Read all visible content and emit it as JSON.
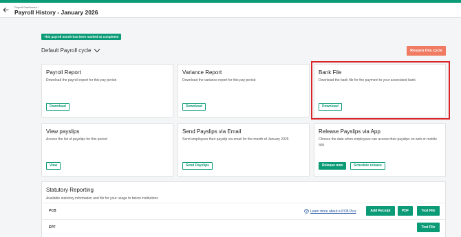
{
  "header": {
    "breadcrumb": "Payroll Dashboard /",
    "title": "Payroll History - January 2026"
  },
  "banner": "This payroll month has been marked as completed",
  "cycle": {
    "label": "Default Payroll cycle"
  },
  "reopen_label": "Reopen this cycle",
  "cards": {
    "payroll_report": {
      "title": "Payroll Report",
      "desc": "Download the payroll report for this pay period",
      "button": "Download"
    },
    "variance_report": {
      "title": "Variance Report",
      "desc": "Download the variance report for this pay period",
      "button": "Download"
    },
    "bank_file": {
      "title": "Bank File",
      "desc": "Download the bank file for the payment to your associated bank",
      "button": "Download"
    },
    "view_payslips": {
      "title": "View payslips",
      "desc": "Access the list of payslips for this period",
      "button": "View"
    },
    "send_payslips": {
      "title": "Send Payslips via Email",
      "desc": "Send employees their payslip via email for the month of January 2026",
      "button": "Send Payslips"
    },
    "release_payslips": {
      "title": "Release Payslips via App",
      "desc": "Choose the date when employees can access their payslips on web or mobile app",
      "button_primary": "Release now",
      "button_secondary": "Schedule release"
    }
  },
  "statutory": {
    "title": "Statutory Reporting",
    "subtitle": "Available statutory information and file for your usage to below institutions",
    "rows": [
      {
        "label": "PCB",
        "learn_more": "Learn more about e-PCB Plus",
        "buttons": [
          "Add Receipt",
          "PDF",
          "Text File"
        ]
      },
      {
        "label": "EPF",
        "buttons": [
          "Text File"
        ]
      }
    ]
  },
  "colors": {
    "accent": "#0c9b77",
    "reopen": "#f07b62",
    "highlight": "#d9252a"
  }
}
